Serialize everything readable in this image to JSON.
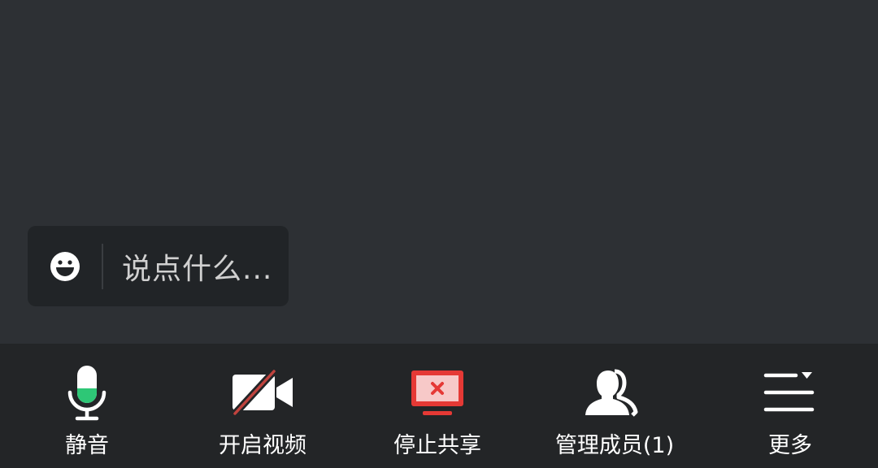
{
  "chat": {
    "placeholder": "说点什么..."
  },
  "toolbar": {
    "items": [
      {
        "label": "静音",
        "icon": "microphone-icon"
      },
      {
        "label": "开启视频",
        "icon": "video-off-icon"
      },
      {
        "label": "停止共享",
        "icon": "stop-share-icon"
      },
      {
        "label": "管理成员(1)",
        "icon": "members-icon"
      },
      {
        "label": "更多",
        "icon": "more-menu-icon"
      }
    ]
  },
  "colors": {
    "background": "#2d3034",
    "toolbar": "#232527",
    "mic_level": "#2ec776",
    "share_red": "#e53935",
    "video_slash": "#c0433e"
  }
}
